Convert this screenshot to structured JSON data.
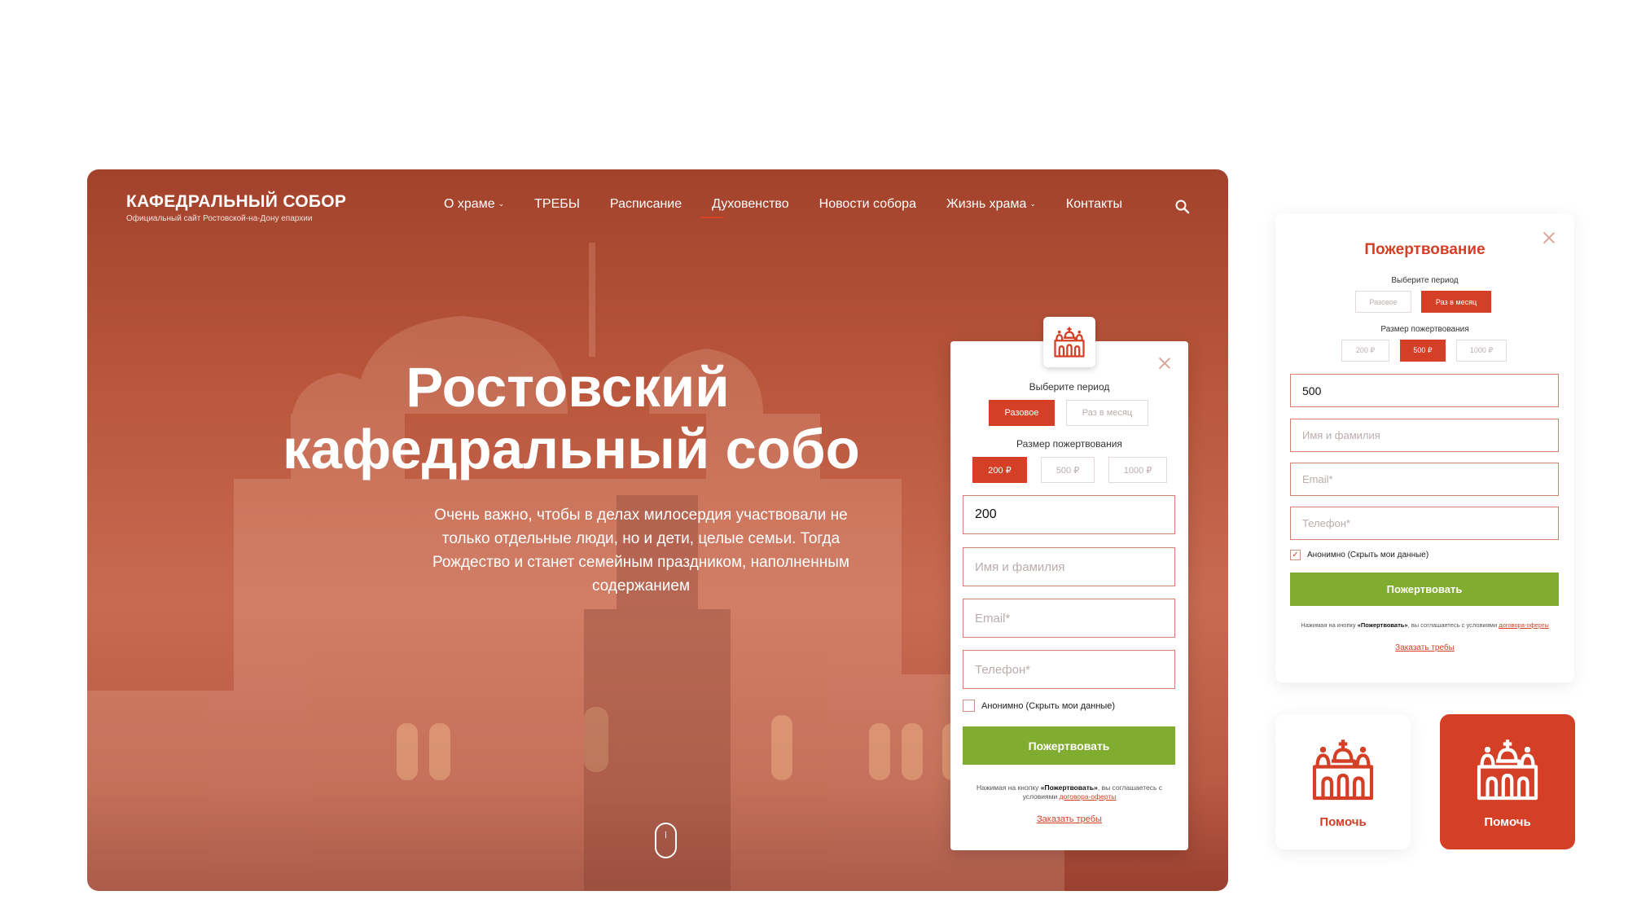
{
  "site": {
    "title": "КАФЕДРАЛЬНЫЙ СОБОР",
    "subtitle": "Официальный сайт Ростовской-на-Дону епархии"
  },
  "nav": {
    "items": [
      "О храме",
      "ТРЕБЫ",
      "Расписание",
      "Духовенство",
      "Новости собора",
      "Жизнь храма",
      "Контакты"
    ],
    "active": "Духовенство"
  },
  "hero": {
    "title_line1": "Ростовский",
    "title_line2": "кафедральный собо",
    "subtitle": "Очень важно, чтобы в делах милосердия участвовали не только отдельные люди, но и дети, целые семьи. Тогда Рождество и станет семейным праздником, наполненным содержанием"
  },
  "donation_form": {
    "period_label": "Выберите период",
    "period_options": [
      "Разовое",
      "Раз в месяц"
    ],
    "period_selected": "Разовое",
    "amount_label": "Размер пожертвования",
    "amount_options": [
      "200 ₽",
      "500 ₽",
      "1000 ₽"
    ],
    "amount_selected": "200 ₽",
    "amount_value": "200",
    "name_placeholder": "Имя и фамилия",
    "email_placeholder": "Email*",
    "phone_placeholder": "Телефон*",
    "anonymous_label": "Анонимно (Скрыть мои данные)",
    "anonymous_checked": false,
    "submit_label": "Пожертвовать",
    "note_prefix": "Нажимая на кнопку",
    "note_button": "«Пожертвовать»",
    "note_middle": ", вы соглашаетесь с условиями",
    "note_link": "договора-оферты",
    "order_link": "Заказать требы"
  },
  "donation_panel": {
    "title": "Пожертвование",
    "period_label": "Выберите период",
    "period_options": [
      "Разовое",
      "Раз в месяц"
    ],
    "period_selected": "Раз в месяц",
    "amount_label": "Размер пожертвования",
    "amount_options": [
      "200 ₽",
      "500 ₽",
      "1000 ₽"
    ],
    "amount_selected": "500 ₽",
    "amount_value": "500",
    "name_placeholder": "Имя и фамилия",
    "email_placeholder": "Email*",
    "phone_placeholder": "Телефон*",
    "anonymous_label": "Анонимно (Скрыть мои данные)",
    "anonymous_checked": true,
    "submit_label": "Пожертвовать",
    "note_prefix": "Нажимая на кнопку",
    "note_button": "«Пожертвовать»",
    "note_middle": ", вы соглашаетесь с условиями",
    "note_link": "договора-оферты",
    "order_link": "Заказать требы"
  },
  "help_tiles": [
    {
      "label": "Помочь",
      "style": "light"
    },
    {
      "label": "Помочь",
      "style": "dark"
    }
  ],
  "colors": {
    "accent": "#d43f26",
    "green": "#80ac2f",
    "hero_overlay": "#b9563c"
  },
  "icons": {
    "church": "church-icon",
    "search": "search-icon",
    "close": "close-icon",
    "chevron": "chevron-down-icon",
    "scroll": "scroll-mouse-icon"
  }
}
